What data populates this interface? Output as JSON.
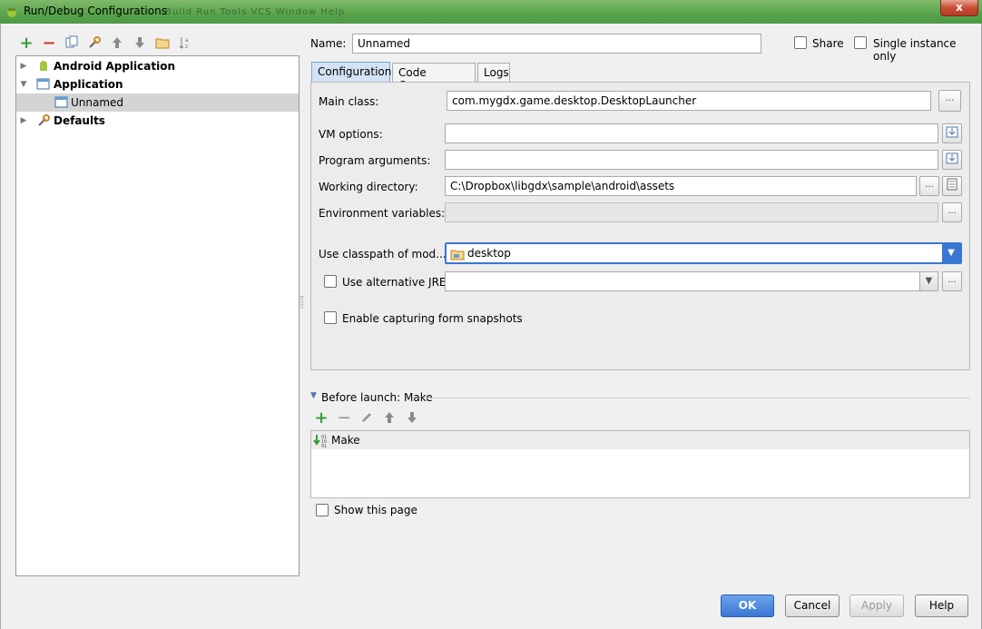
{
  "window": {
    "title": "Run/Debug Configurations",
    "close_label": "x",
    "blurred_menu": "Build  Run  Tools  VCS  Window  Help"
  },
  "toolbar": {
    "icons": [
      "add-icon",
      "remove-icon",
      "copy-icon",
      "edit-defaults-icon",
      "move-up-icon",
      "move-down-icon",
      "folder-icon",
      "sort-icon"
    ]
  },
  "tree": {
    "items": [
      {
        "label": "Android Application",
        "expanded": false
      },
      {
        "label": "Application",
        "expanded": true
      },
      {
        "label": "Unnamed",
        "selected": true
      },
      {
        "label": "Defaults",
        "expanded": false
      }
    ]
  },
  "header": {
    "name_label": "Name:",
    "name_value": "Unnamed",
    "share_label": "Share",
    "single_instance_label": "Single instance only"
  },
  "tabs": [
    {
      "label": "Configuration",
      "active": true
    },
    {
      "label": "Code Coverage",
      "active": false
    },
    {
      "label": "Logs",
      "active": false
    }
  ],
  "form": {
    "main_class_label": "Main class:",
    "main_class_value": "com.mygdx.game.desktop.DesktopLauncher",
    "vm_options_label": "VM options:",
    "vm_options_value": "",
    "program_args_label": "Program arguments:",
    "program_args_value": "",
    "working_dir_label": "Working directory:",
    "working_dir_value": "C:\\Dropbox\\libgdx\\sample\\android\\assets",
    "env_vars_label": "Environment variables:",
    "env_vars_value": "",
    "classpath_label": "Use classpath of mod...",
    "classpath_value": "desktop",
    "alt_jre_label": "Use alternative JRE:",
    "alt_jre_value": "",
    "snapshots_label": "Enable capturing form snapshots",
    "ellipsis": "..."
  },
  "before_launch": {
    "title": "Before launch: Make",
    "items": [
      "Make"
    ]
  },
  "show_page_label": "Show this page",
  "buttons": {
    "ok": "OK",
    "cancel": "Cancel",
    "apply": "Apply",
    "help": "Help"
  },
  "colors": {
    "accent": "#3b77d4",
    "add_green": "#3a9a3a",
    "remove_red": "#d03a2a"
  }
}
